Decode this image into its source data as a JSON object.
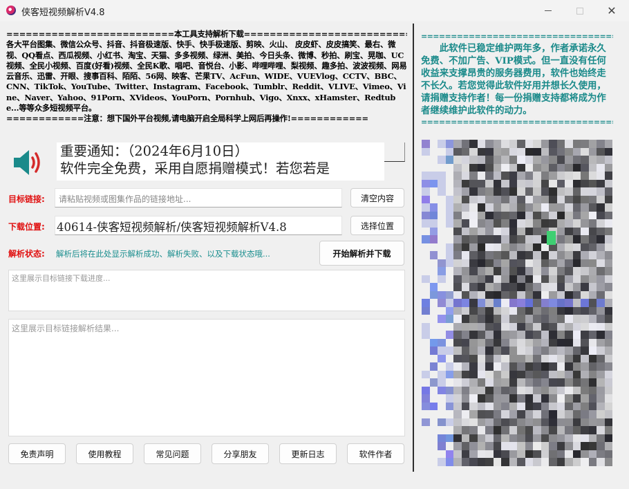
{
  "window": {
    "title": "侠客短视频解析V4.8",
    "minimize_icon": "minimize-icon",
    "maximize_icon": "maximize-icon",
    "close_icon": "close-icon",
    "close_glyph": "✕"
  },
  "intro": {
    "header": "==========================本工具支持解析下载=============================",
    "body": "各大平台图集、微信公众号、抖音、抖音极速版、快手、快手极速版、剪映、火山、 皮皮虾、皮皮搞笑、最右、微视、QQ看点、西瓜视频、小红书、淘宝、天猫、多多视频、绿洲、美拍、今日头条、微博、秒拍、刷宝、晃咖、UC视频、全民小视频、百度(好看)视频、全民K歌、唱吧、音悦台、小影、哔哩哔哩、梨视频、趣多拍、波波视频、网易云音乐、迅雷、开眼、搜事百科、陌陌、56网、映客、芒果TV、AcFun、WIDE、VUEVlog、CCTV、BBC、CNN、TikTok、YouTube、Twitter、Instagram、Facebook、Tumblr、Reddit、VLIVE、Vimeo、Vine、Naver、Yahoo、91Porn、XVideos、YouPorn、Pornhub、Vigo、Xnxx、xHamster、Redtube...等等众多短视频平台。",
    "footer": "============注意：想下国外平台视频,请电脑开启全局科学上网后再操作!============"
  },
  "notice": {
    "icon": "speaker-icon",
    "line1": "重要通知：（2024年6月10日）",
    "line2": "软件完全免费，采用自愿捐赠模式！若您若是"
  },
  "form": {
    "link_label": "目标链接:",
    "link_placeholder": "请粘贴视频或图集作品的链接地址...",
    "clear_button": "清空内容",
    "path_label": "下载位置:",
    "path_value": "40614-侠客短视频解析/侠客短视频解析V4.8",
    "choose_button": "选择位置",
    "status_label": "解析状态:",
    "status_text": "解析后将在此处显示解析成功、解析失败、以及下载状态哦...",
    "start_button": "开始解析并下载",
    "progress_placeholder": "这里展示目标链接下载进度...",
    "result_placeholder": "这里展示目标链接解析结果..."
  },
  "bottom_buttons": {
    "disclaimer": "免责声明",
    "tutorial": "使用教程",
    "faq": "常见问题",
    "share": "分享朋友",
    "changelog": "更新日志",
    "author": "软件作者"
  },
  "sidebar": {
    "separator_top": "=====================================================",
    "donation_text": "此软件已稳定维护两年多，作者承诺永久免费、不加广告、VIP模式。但一直没有任何收益来支撑昂贵的服务器费用，软件也始终走不长久。若您觉得此软件好用并想长久使用，请捐赠支持作者！每一份捐赠支持都将成为作者继续维护此软件的动力。",
    "separator_bottom": "=====================================================",
    "qr_icon": "donation-qr-code-icon"
  },
  "colors": {
    "label_red": "#e01010",
    "status_teal": "#1a8e8e",
    "donation_teal": "#1a8a8a",
    "speaker_teal": "#1a8a8a",
    "speaker_wave_red": "#d42b2b"
  }
}
